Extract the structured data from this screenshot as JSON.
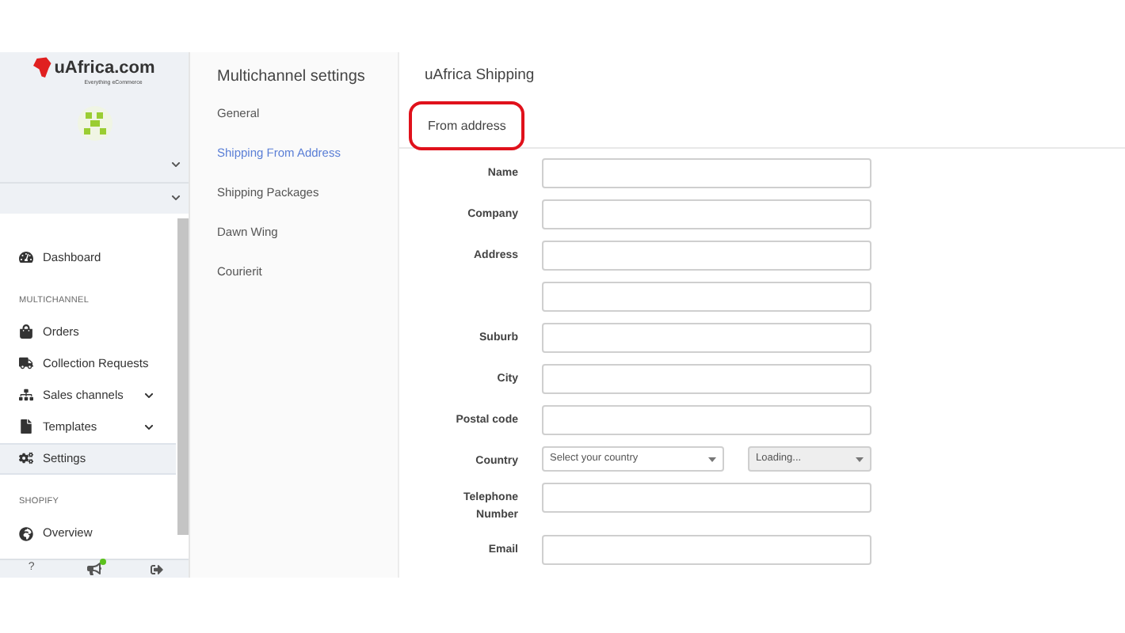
{
  "sidebar": {
    "logo": {
      "brand": "uAfrica.com",
      "tagline": "Everything eCommerce"
    },
    "sections": [
      {
        "items": [
          {
            "label": "Dashboard",
            "expandable": false,
            "selected": false
          }
        ]
      },
      {
        "heading": "MULTICHANNEL",
        "items": [
          {
            "label": "Orders",
            "expandable": false,
            "selected": false
          },
          {
            "label": "Collection Requests",
            "expandable": false,
            "selected": false
          },
          {
            "label": "Sales channels",
            "expandable": true,
            "selected": false
          },
          {
            "label": "Templates",
            "expandable": true,
            "selected": false
          },
          {
            "label": "Settings",
            "expandable": false,
            "selected": true
          }
        ]
      },
      {
        "heading": "SHOPIFY",
        "items": [
          {
            "label": "Overview",
            "expandable": false,
            "selected": false
          }
        ]
      }
    ],
    "footer": {
      "help": "?",
      "notification": true
    }
  },
  "settings_menu": {
    "title": "Multichannel settings",
    "items": [
      {
        "label": "General",
        "selected": false
      },
      {
        "label": "Shipping From Address",
        "selected": true
      },
      {
        "label": "Shipping Packages",
        "selected": false
      },
      {
        "label": "Dawn Wing",
        "selected": false
      },
      {
        "label": "Courierit",
        "selected": false
      }
    ]
  },
  "main": {
    "title": "uAfrica Shipping",
    "tab": {
      "label": "From address",
      "highlighted": true
    },
    "fields": [
      {
        "label": "Name",
        "kind": "text"
      },
      {
        "label": "Company",
        "kind": "text"
      },
      {
        "label": "Address",
        "kind": "text"
      },
      {
        "kind": "text"
      },
      {
        "label": "Suburb",
        "kind": "text"
      },
      {
        "label": "City",
        "kind": "text"
      },
      {
        "label": "Postal code",
        "kind": "text"
      },
      {
        "label": "Country",
        "kind": "selects",
        "selects": [
          {
            "placeholder": "Select your country",
            "disabled": false
          },
          {
            "placeholder": "Loading...",
            "disabled": true
          }
        ]
      },
      {
        "label": "Telephone Number",
        "kind": "text"
      },
      {
        "label": "Email",
        "kind": "text"
      }
    ]
  }
}
